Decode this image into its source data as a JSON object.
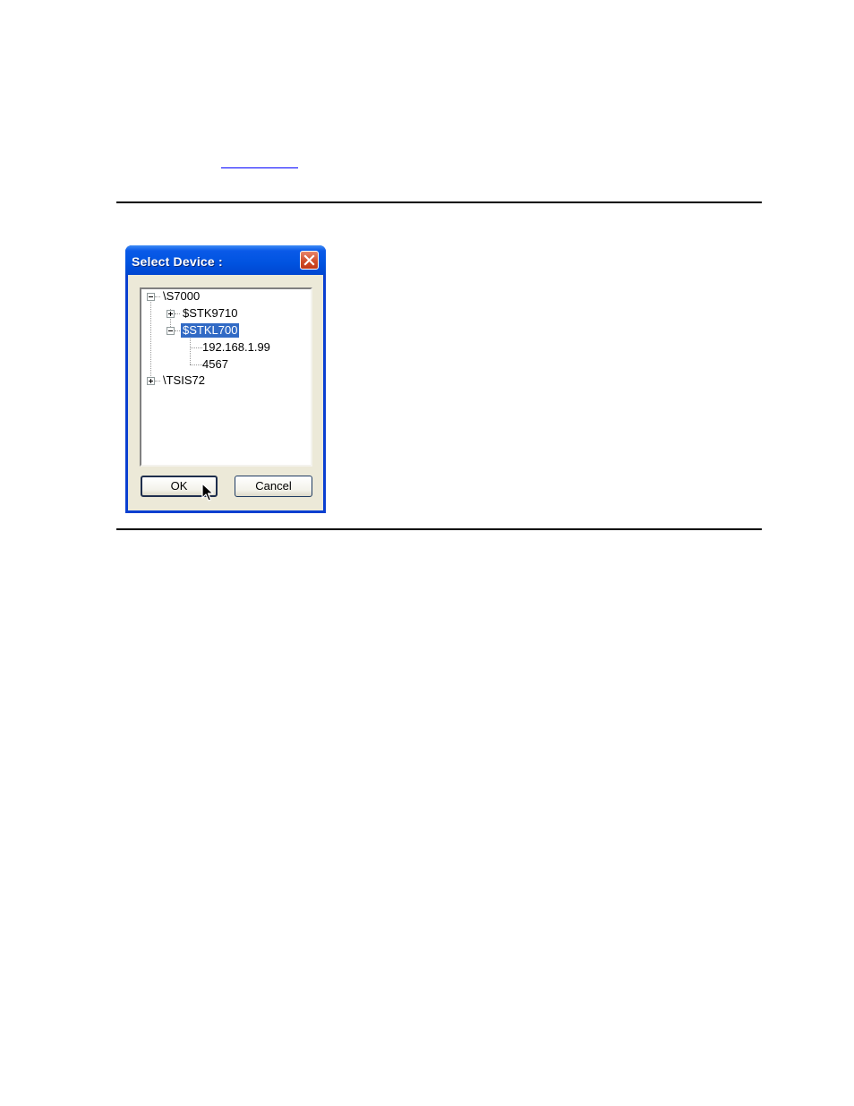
{
  "dialog": {
    "title": "Select Device :",
    "close_icon": "close-icon",
    "tree": {
      "root1": {
        "label": "\\S7000",
        "expanded": true
      },
      "root1_child1": {
        "label": "$STK9710",
        "expanded": false
      },
      "root1_child2": {
        "label": "$STKL700",
        "expanded": true,
        "selected": true
      },
      "leaf1": {
        "label": "192.168.1.99"
      },
      "leaf2": {
        "label": "4567"
      },
      "root2": {
        "label": "\\TSIS72",
        "expanded": false
      }
    },
    "buttons": {
      "ok": "OK",
      "cancel": "Cancel"
    },
    "cursor_icon": "mouse-pointer-icon"
  },
  "colors": {
    "titlebar": "#0053e0",
    "selection": "#316ac5",
    "client": "#ece9d8",
    "close": "#cf4a26",
    "link": "#0000ff"
  }
}
